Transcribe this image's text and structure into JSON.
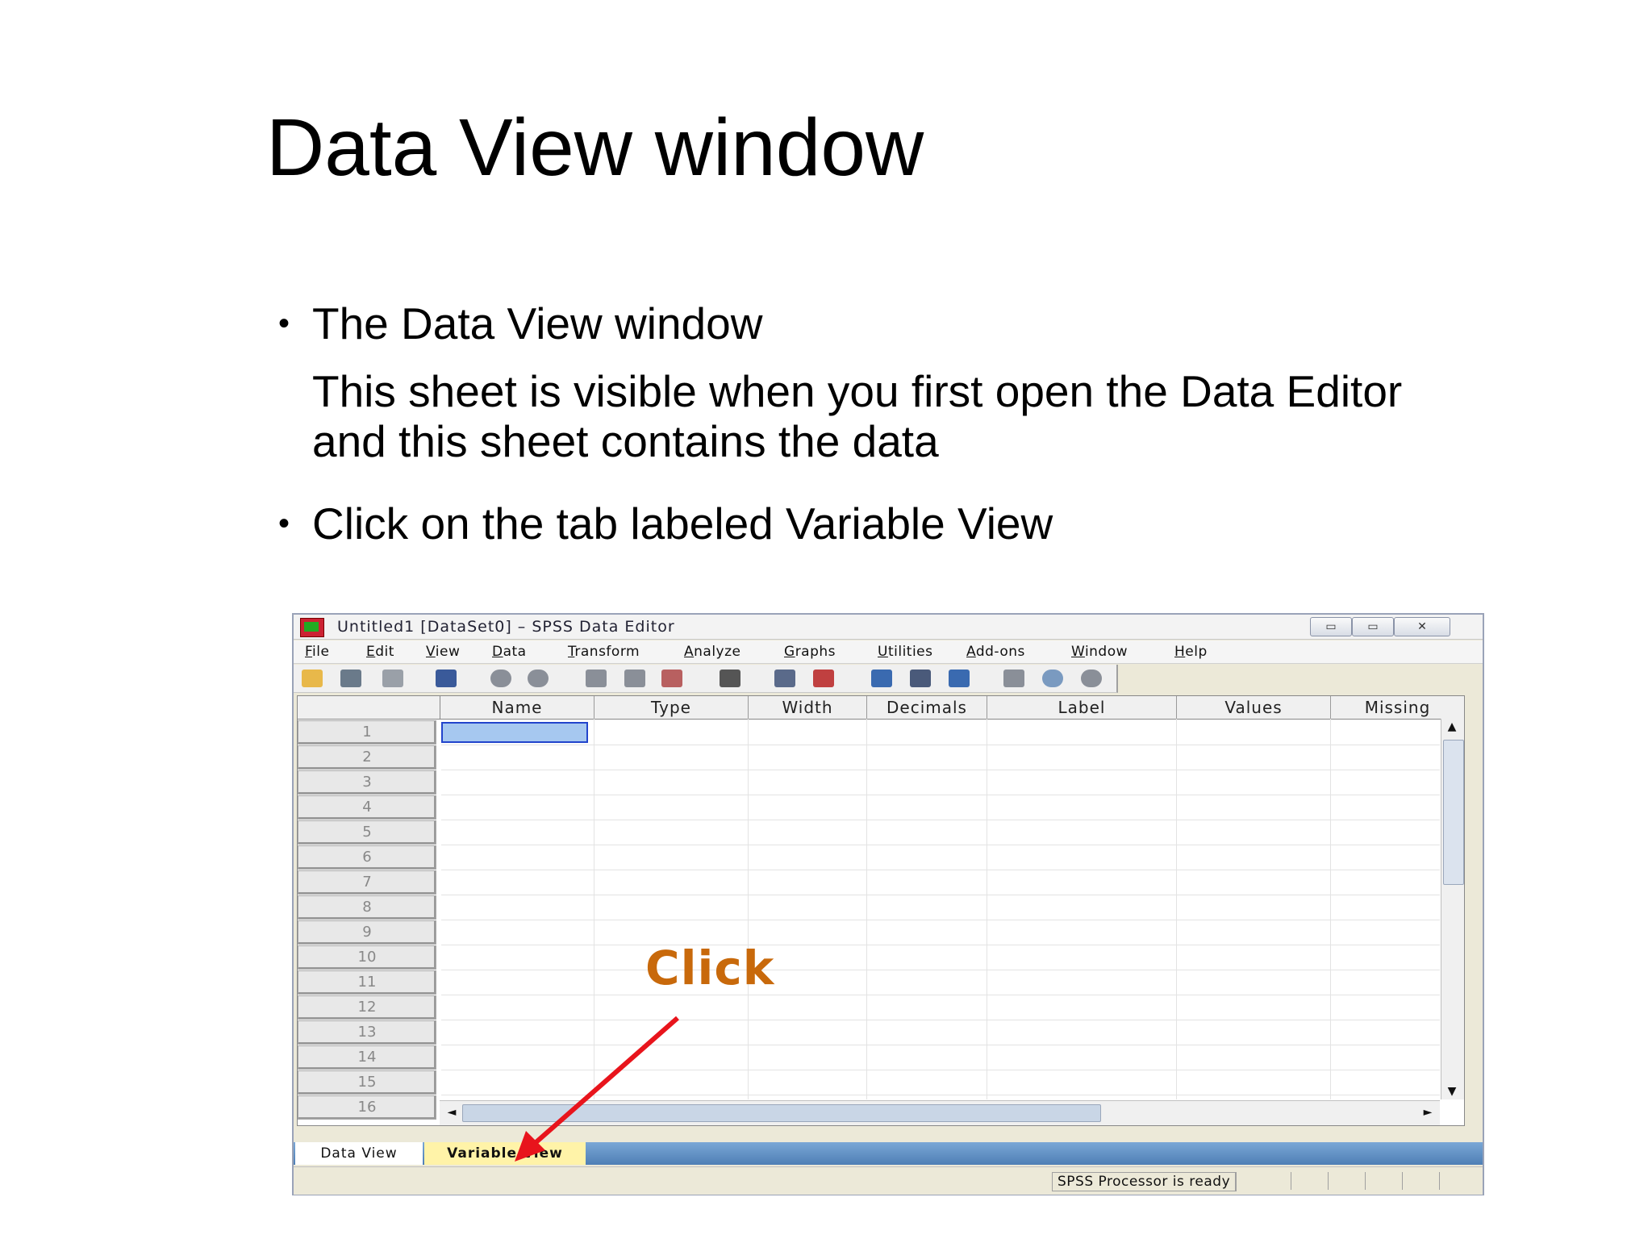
{
  "slide": {
    "title": "Data View window",
    "bullets": [
      {
        "text": "The Data View window",
        "sub": "This sheet is visible when you first open the Data Editor and this sheet contains the data"
      },
      {
        "text": "Click on the tab labeled Variable View"
      }
    ]
  },
  "window": {
    "title": "Untitled1 [DataSet0] – SPSS Data Editor",
    "controls": {
      "minimize": "▭",
      "maximize": "▭",
      "close": "✕"
    },
    "menu": [
      "File",
      "Edit",
      "View",
      "Data",
      "Transform",
      "Analyze",
      "Graphs",
      "Utilities",
      "Add-ons",
      "Window",
      "Help"
    ],
    "toolbar_icons": [
      "open-folder-icon",
      "save-icon",
      "print-icon",
      "dialog-recall-icon",
      "undo-icon",
      "redo-icon",
      "goto-case-icon",
      "goto-variable-icon",
      "variables-icon",
      "find-icon",
      "insert-cases-icon",
      "insert-variable-icon",
      "split-file-icon",
      "weight-cases-icon",
      "select-cases-icon",
      "value-labels-icon",
      "use-sets-icon",
      "show-all-icon"
    ],
    "columns": [
      "Name",
      "Type",
      "Width",
      "Decimals",
      "Label",
      "Values",
      "Missing"
    ],
    "rows": [
      "1",
      "2",
      "3",
      "4",
      "5",
      "6",
      "7",
      "8",
      "9",
      "10",
      "11",
      "12",
      "13",
      "14",
      "15",
      "16"
    ],
    "tabs": {
      "data_view": "Data View",
      "variable_view": "Variable View"
    },
    "status": "SPSS  Processor is ready",
    "scroll": {
      "up": "▲",
      "down": "▼",
      "left": "◄",
      "right": "►"
    }
  },
  "annotation": {
    "label": "Click",
    "color": "#c8690b",
    "arrow_color": "#e8141c"
  }
}
